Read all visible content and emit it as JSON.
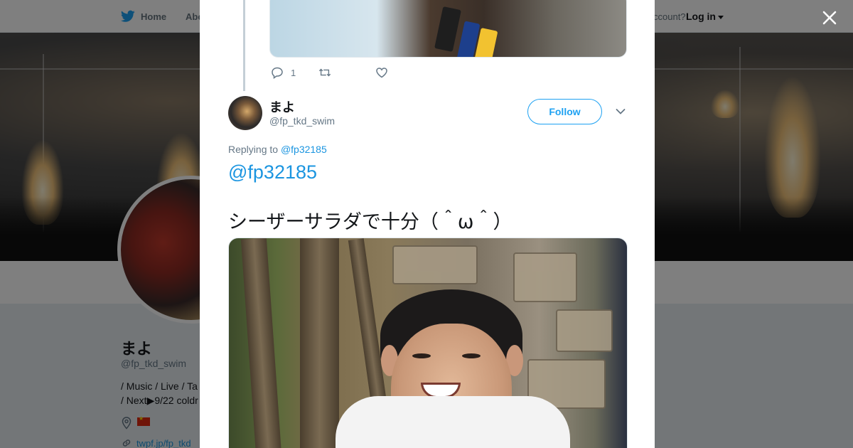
{
  "topbar": {
    "home_label": "Home",
    "about_label": "Abo",
    "account_text": "ccount?",
    "login_label": "Log in"
  },
  "profile": {
    "name": "まよ",
    "handle": "@fp_tkd_swim",
    "bio_line1": "/ Music / Live / Ta",
    "bio_line2": "/ Next▶9/22 coldr",
    "link": "twpf.jp/fp_tkd"
  },
  "modal": {
    "previous_tweet": {
      "reply_count": "1"
    },
    "tweet": {
      "author_name": "まよ",
      "author_handle": "@fp_tkd_swim",
      "follow_label": "Follow",
      "replying_prefix": "Replying to",
      "replying_to": "@fp32185",
      "mention": "@fp32185",
      "text": "シーザーサラダで十分（＾ω＾）"
    }
  },
  "colors": {
    "accent": "#1da1f2",
    "link": "#1b95e0",
    "muted": "#657786"
  },
  "icons": {
    "close": "close-icon",
    "reply": "reply-icon",
    "retweet": "retweet-icon",
    "like": "heart-icon",
    "more": "chevron-down-icon",
    "location": "location-icon",
    "link": "link-icon",
    "bird": "twitter-bird-icon"
  }
}
